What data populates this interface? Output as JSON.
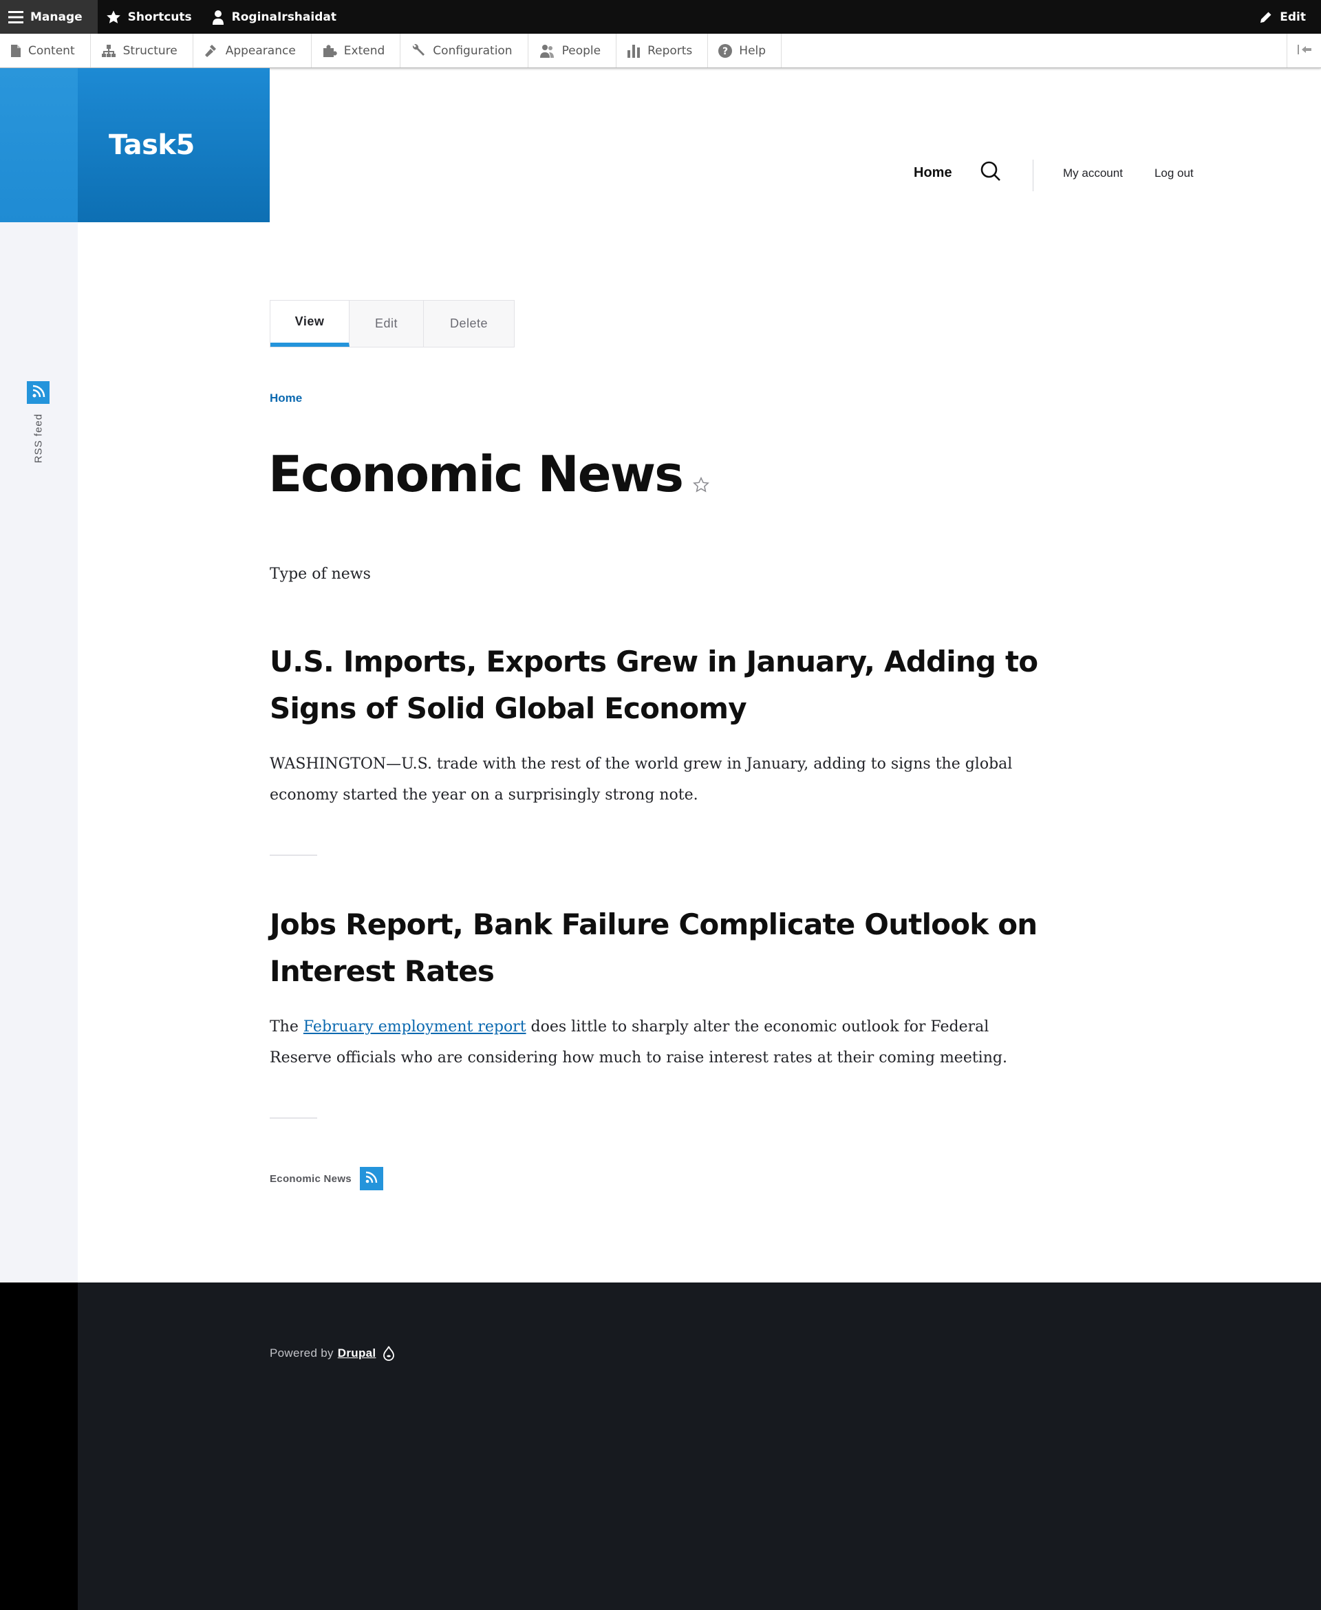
{
  "toolbar": {
    "manage_label": "Manage",
    "shortcuts_label": "Shortcuts",
    "user_label": "RoginaIrshaidat",
    "edit_label": "Edit",
    "tray": [
      {
        "label": "Content",
        "icon": "file-icon"
      },
      {
        "label": "Structure",
        "icon": "sitemap-icon"
      },
      {
        "label": "Appearance",
        "icon": "paintbrush-icon"
      },
      {
        "label": "Extend",
        "icon": "puzzle-icon"
      },
      {
        "label": "Configuration",
        "icon": "wrench-icon"
      },
      {
        "label": "People",
        "icon": "people-icon"
      },
      {
        "label": "Reports",
        "icon": "bar-chart-icon"
      },
      {
        "label": "Help",
        "icon": "help-icon"
      }
    ]
  },
  "site": {
    "name": "Task5"
  },
  "main_nav": {
    "home": "Home"
  },
  "user_nav": {
    "account": "My account",
    "logout": "Log out"
  },
  "sidebar": {
    "rss_label": "RSS feed"
  },
  "tabs": [
    {
      "label": "View",
      "active": true
    },
    {
      "label": "Edit",
      "active": false
    },
    {
      "label": "Delete",
      "active": false
    }
  ],
  "breadcrumb": {
    "home": "Home"
  },
  "page": {
    "title": "Economic News",
    "description": "Type of news"
  },
  "articles": [
    {
      "title": "U.S. Imports, Exports Grew in January, Adding to Signs of Solid Global Economy",
      "body": "WASHINGTON—U.S. trade with the rest of the world grew in January, adding to signs the global economy started the year on a surprisingly strong note."
    },
    {
      "title": "Jobs Report, Bank Failure Complicate Outlook on Interest Rates",
      "body_prefix": "The ",
      "body_link": "February employment report",
      "body_suffix": " does little to sharply alter the economic outlook for Federal Reserve officials who are considering how much to raise interest rates at their coming meeting."
    }
  ],
  "feed": {
    "label": "Economic News"
  },
  "footer": {
    "powered_by": "Powered by",
    "drupal": "Drupal"
  },
  "colors": {
    "accent": "#2494db",
    "brand_dark": "#0d6fb3",
    "link": "#0b69b0",
    "footer_bg": "#171a1f"
  }
}
